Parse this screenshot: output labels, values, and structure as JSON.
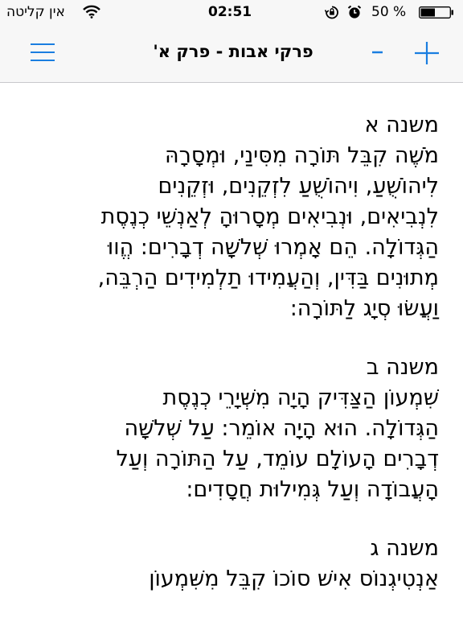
{
  "status_bar": {
    "carrier": "אין קליטה",
    "time": "02:51",
    "battery_percent": "50 %",
    "battery_level": 0.5,
    "icons": [
      "wifi-icon",
      "orientation-lock-icon",
      "alarm-icon",
      "battery-icon"
    ]
  },
  "nav": {
    "title": "פרקי אבות - פרק א'",
    "zoom_in_label": "+",
    "zoom_out_label": "-",
    "menu_icon": "menu-icon",
    "accent_color": "#1a7ee0"
  },
  "mishnayot": [
    {
      "heading": "משנה א",
      "lines": [
        "מֹשֶׁה קִבֵּל תּוֹרָה מִסִּינַי, וּמְסָרָהּ",
        "לִיהוֹשֻׁעַ, וִיהוֹשֻׁעַ לִזְקֵנִים, וּזְקֵנִים",
        "לִנְבִיאִים, וּנְבִיאִים מְסָרוּהָ לְאַנְשֵׁי כְנֶסֶת",
        "הַגְּדוֹלָה. הֵם אָמְרוּ שְׁלשָׁה דְבָרִים: הֱווּ",
        "מְתוּנִים בַּדִּין, וְהַעֲמִידוּ תַלְמִידִים הַרְבֵּה,",
        "וַעֲשׂוּ סְיָג לַתּוֹרָה:"
      ]
    },
    {
      "heading": "משנה ב",
      "lines": [
        "שִׁמְעוֹן הַצַּדִּיק הָיָה מִשְּׁיָרֵי כְנֶסֶת",
        "הַגְּדוֹלָה. הוּא הָיָה אוֹמֵר: עַל שְׁלשָׁה",
        "דְבָרִים הָעוֹלָם עוֹמֵד, עַל הַתּוֹרָה וְעַל",
        "הָעֲבוֹדָה וְעַל גְּמִילוּת חֲסָדִים:"
      ]
    },
    {
      "heading": "משנה ג",
      "lines": [
        "אַנְטִיגְנוֹס אִישׁ סוֹכוֹ קִבֵּל מִשִּׁמְעוֹן"
      ]
    }
  ]
}
